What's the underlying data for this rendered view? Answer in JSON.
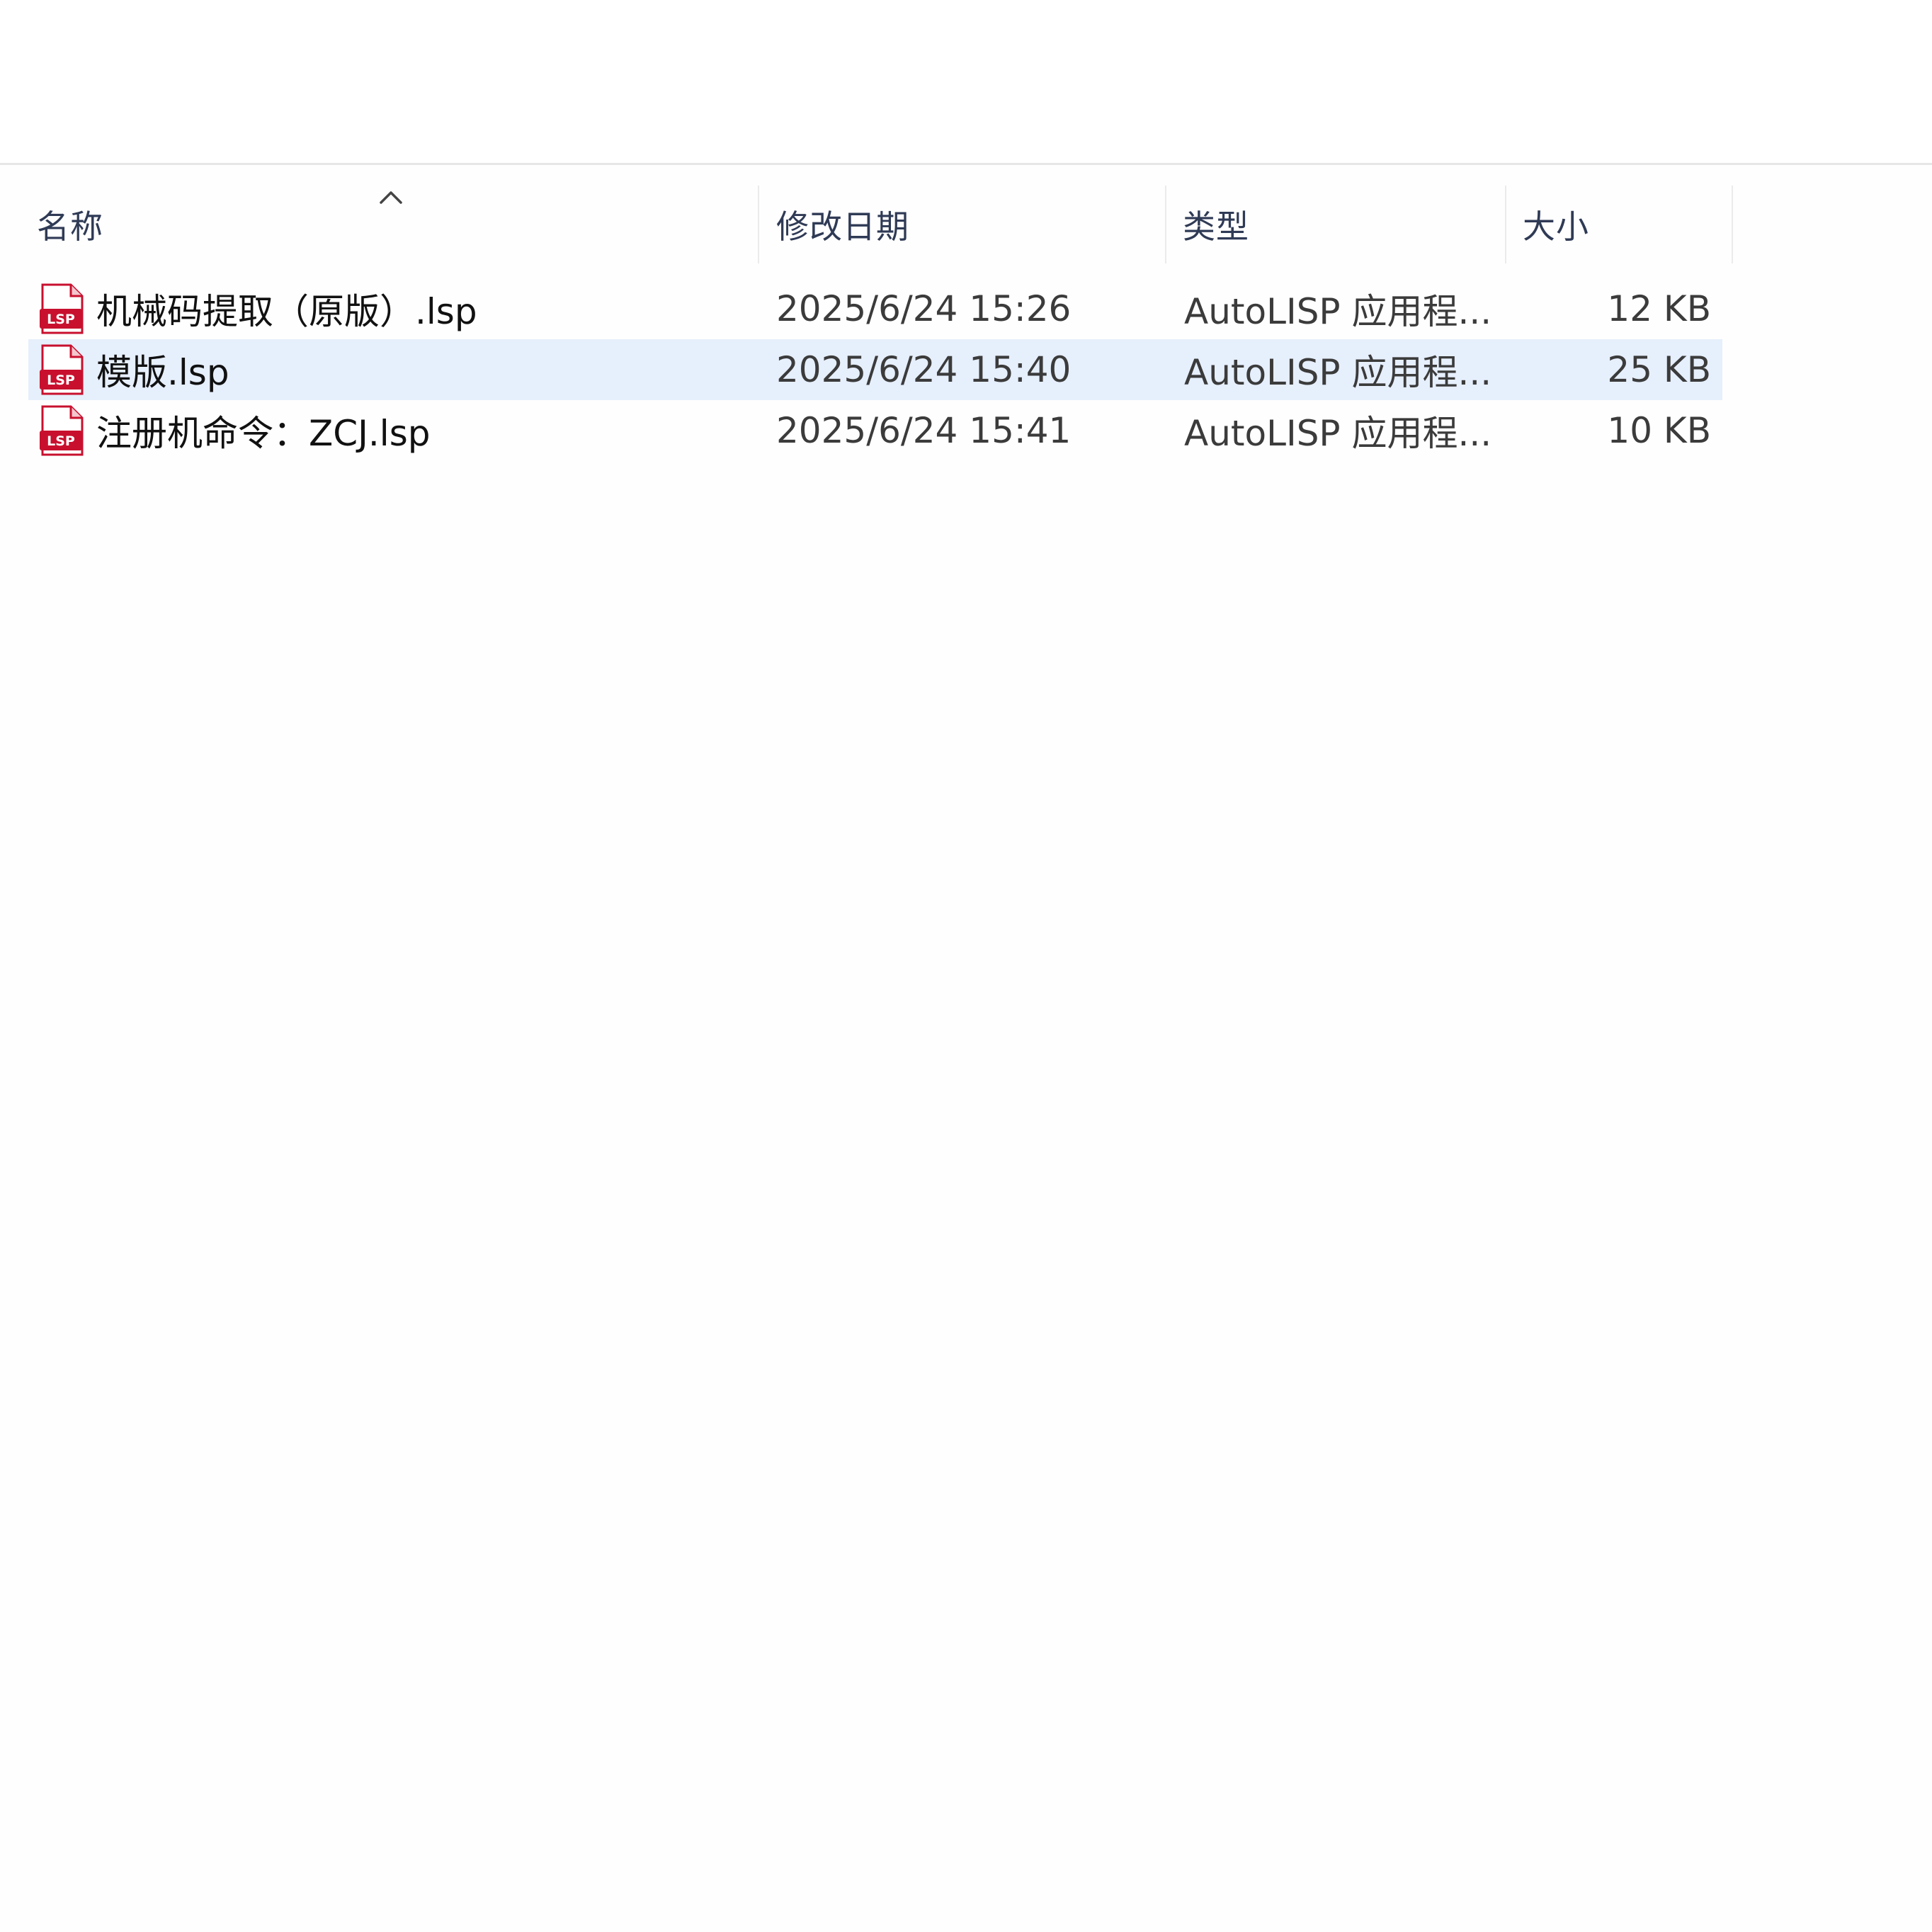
{
  "columns": {
    "name": "名称",
    "modified": "修改日期",
    "type": "类型",
    "size": "大小"
  },
  "files": [
    {
      "name": "机械码提取（原版）.lsp",
      "modified": "2025/6/24 15:26",
      "type": "AutoLISP 应用程...",
      "size": "12 KB",
      "selected": false
    },
    {
      "name": "模版.lsp",
      "modified": "2025/6/24 15:40",
      "type": "AutoLISP 应用程...",
      "size": "25 KB",
      "selected": true
    },
    {
      "name": "注册机命令：ZCJ.lsp",
      "modified": "2025/6/24 15:41",
      "type": "AutoLISP 应用程...",
      "size": "10 KB",
      "selected": false
    }
  ],
  "icons": {
    "file": "lsp-file-icon",
    "sort": "chevron-up-icon"
  },
  "colors": {
    "selection": "#e6effc",
    "icon_red": "#c8102e"
  }
}
